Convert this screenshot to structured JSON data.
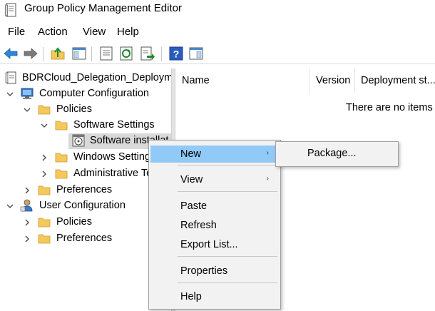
{
  "window": {
    "title": "Group Policy Management Editor"
  },
  "menubar": {
    "items": [
      "File",
      "Action",
      "View",
      "Help"
    ]
  },
  "toolbar": {
    "buttons": [
      "back-icon",
      "forward-icon",
      "up-folder-icon",
      "show-hide-tree-icon",
      "properties-icon",
      "refresh-icon",
      "export-list-icon",
      "help-icon",
      "show-action-pane-icon"
    ]
  },
  "tree": {
    "root": "BDRCloud_Delegation_Deploym",
    "computer_config": "Computer Configuration",
    "cc_policies": "Policies",
    "software_settings": "Software Settings",
    "software_installation": "Software installat",
    "windows_settings": "Windows Setting",
    "admin_templates": "Administrative Te",
    "cc_preferences": "Preferences",
    "user_config": "User Configuration",
    "uc_policies": "Policies",
    "uc_preferences": "Preferences"
  },
  "list": {
    "columns": [
      "Name",
      "Version",
      "Deployment st..."
    ],
    "empty_message": "There are no items t"
  },
  "context_menu": {
    "new": "New",
    "view": "View",
    "paste": "Paste",
    "refresh": "Refresh",
    "export_list": "Export List...",
    "properties": "Properties",
    "help": "Help"
  },
  "submenu": {
    "package": "Package..."
  },
  "colors": {
    "highlight": "#91c9f7",
    "menu_bg": "#f2f2f2",
    "folder": "#f5c85a"
  }
}
